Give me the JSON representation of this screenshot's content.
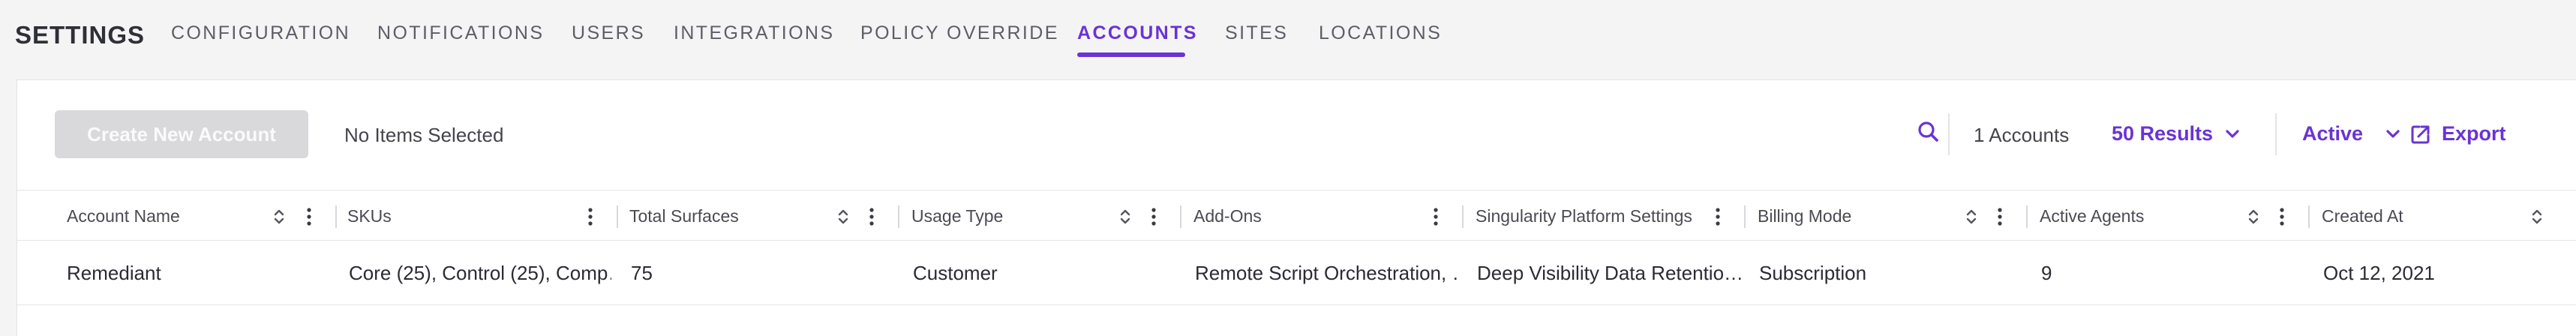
{
  "header": {
    "title": "SETTINGS",
    "tabs": [
      {
        "label": "CONFIGURATION"
      },
      {
        "label": "NOTIFICATIONS"
      },
      {
        "label": "USERS"
      },
      {
        "label": "INTEGRATIONS"
      },
      {
        "label": "POLICY OVERRIDE"
      },
      {
        "label": "ACCOUNTS",
        "active": true
      },
      {
        "label": "SITES"
      },
      {
        "label": "LOCATIONS"
      }
    ]
  },
  "toolbar": {
    "create_label": "Create New Account",
    "selection_text": "No Items Selected",
    "count_text": "1 Accounts",
    "results_label": "50 Results",
    "filter_label": "Active",
    "export_label": "Export"
  },
  "table": {
    "columns": [
      {
        "label": "Account Name"
      },
      {
        "label": "SKUs"
      },
      {
        "label": "Total Surfaces"
      },
      {
        "label": "Usage Type"
      },
      {
        "label": "Add-Ons"
      },
      {
        "label": "Singularity Platform Settings"
      },
      {
        "label": "Billing Mode"
      },
      {
        "label": "Active Agents"
      },
      {
        "label": "Created At"
      }
    ],
    "rows": [
      {
        "cells": [
          "Remediant",
          "Core (25), Control (25), Comp…",
          "75",
          "Customer",
          "Remote Script Orchestration, …",
          "Deep Visibility Data Retentio…",
          "Subscription",
          "9",
          "Oct 12, 2021"
        ]
      }
    ]
  },
  "colors": {
    "accent": "#6a33d4",
    "background": "#f4f4f5",
    "panel": "#ffffff",
    "disabled_button": "#d9d9dc"
  }
}
